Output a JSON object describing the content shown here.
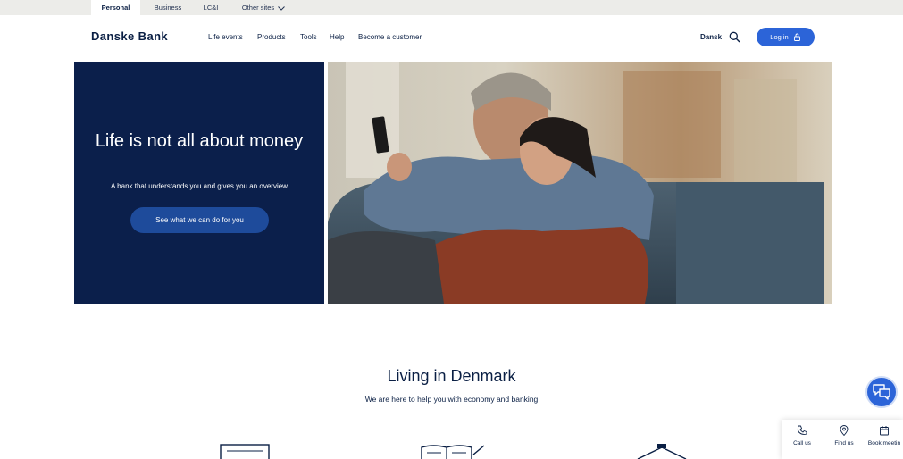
{
  "utility_bar": {
    "tabs": [
      {
        "label": "Personal",
        "active": true
      },
      {
        "label": "Business",
        "active": false
      },
      {
        "label": "LC&I",
        "active": false
      },
      {
        "label": "Other sites",
        "active": false
      }
    ]
  },
  "header": {
    "logo": "Danske Bank",
    "nav": [
      "Life events",
      "Products",
      "Tools",
      "Help",
      "Become a customer"
    ],
    "language": "Dansk",
    "search_icon": "search-icon",
    "login_label": "Log in",
    "login_icon": "lock-icon"
  },
  "hero": {
    "title": "Life is not all about money",
    "subtitle": "A bank that understands you and gives you an overview",
    "cta": "See what we can do for you",
    "image": "couple-on-sofa-with-phone"
  },
  "section": {
    "title": "Living in Denmark",
    "subtitle": "We are here to help you with economy and banking"
  },
  "floating": {
    "chat_icon": "chat-bubbles-icon",
    "contact": [
      {
        "label": "Call us",
        "icon": "phone-icon"
      },
      {
        "label": "Find us",
        "icon": "location-pin-icon"
      },
      {
        "label": "Book meetin",
        "icon": "calendar-icon"
      }
    ]
  },
  "colors": {
    "navy": "#0b1f4b",
    "accent_blue": "#2c64d8",
    "utility_gray": "#ecece9"
  }
}
